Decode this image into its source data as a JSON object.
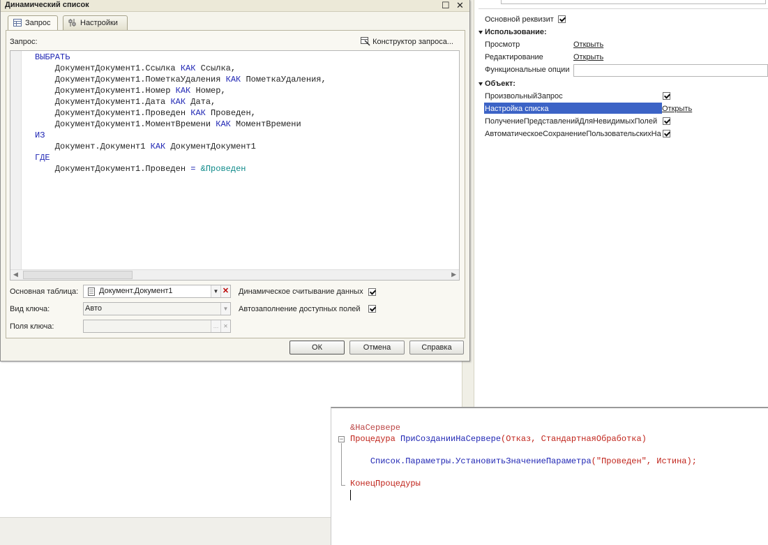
{
  "dialog": {
    "title": "Динамический список",
    "tabs": [
      {
        "label": "Запрос"
      },
      {
        "label": "Настройки"
      }
    ],
    "query_label": "Запрос:",
    "constructor_label": "Конструктор запроса...",
    "query_text": "ВЫБРАТЬ\n\tДокументДокумент1.Ссылка КАК Ссылка,\n\tДокументДокумент1.ПометкаУдаления КАК ПометкаУдаления,\n\tДокументДокумент1.Номер КАК Номер,\n\tДокументДокумент1.Дата КАК Дата,\n\tДокументДокумент1.Проведен КАК Проведен,\n\tДокументДокумент1.МоментВремени КАК МоментВремени\nИЗ\n\tДокумент.Документ1 КАК ДокументДокумент1\nГДЕ\n\tДокументДокумент1.Проведен = &Проведен",
    "main_table_label": "Основная таблица:",
    "main_table_value": "Документ.Документ1",
    "key_type_label": "Вид ключа:",
    "key_type_value": "Авто",
    "key_fields_label": "Поля ключа:",
    "key_fields_value": "",
    "dynamic_read_label": "Динамическое считывание данных",
    "dynamic_read_checked": true,
    "autofill_label": "Автозаполнение доступных полей",
    "autofill_checked": true,
    "buttons": {
      "ok": "ОК",
      "cancel": "Отмена",
      "help": "Справка"
    }
  },
  "properties": {
    "main_attribute_label": "Основной реквизит",
    "main_attribute_checked": true,
    "usage_section": "Использование:",
    "view_label": "Просмотр",
    "view_link": "Открыть",
    "edit_label": "Редактирование",
    "edit_link": "Открыть",
    "func_options_label": "Функциональные опции",
    "object_section": "Объект:",
    "custom_query_label": "ПроизвольныйЗапрос",
    "custom_query_checked": true,
    "list_settings_label": "Настройка списка",
    "list_settings_link": "Открыть",
    "get_repr_label": "ПолучениеПредставленийДляНевидимыхПолей",
    "get_repr_checked": true,
    "autosave_label": "АвтоматическоеСохранениеПользовательскихНа",
    "autosave_checked": true
  },
  "code": {
    "directive": "&НаСервере",
    "proc_keyword": "Процедура",
    "proc_name": "ПриСозданииНаСервере",
    "proc_params": "(Отказ, СтандартнаяОбработка)",
    "line_obj": "Список.Параметры.УстановитьЗначениеПараметра",
    "line_arg1": "(\"Проведен\", ",
    "line_arg2": "Истина",
    "line_end": ");",
    "end_keyword": "КонецПроцедуры"
  }
}
